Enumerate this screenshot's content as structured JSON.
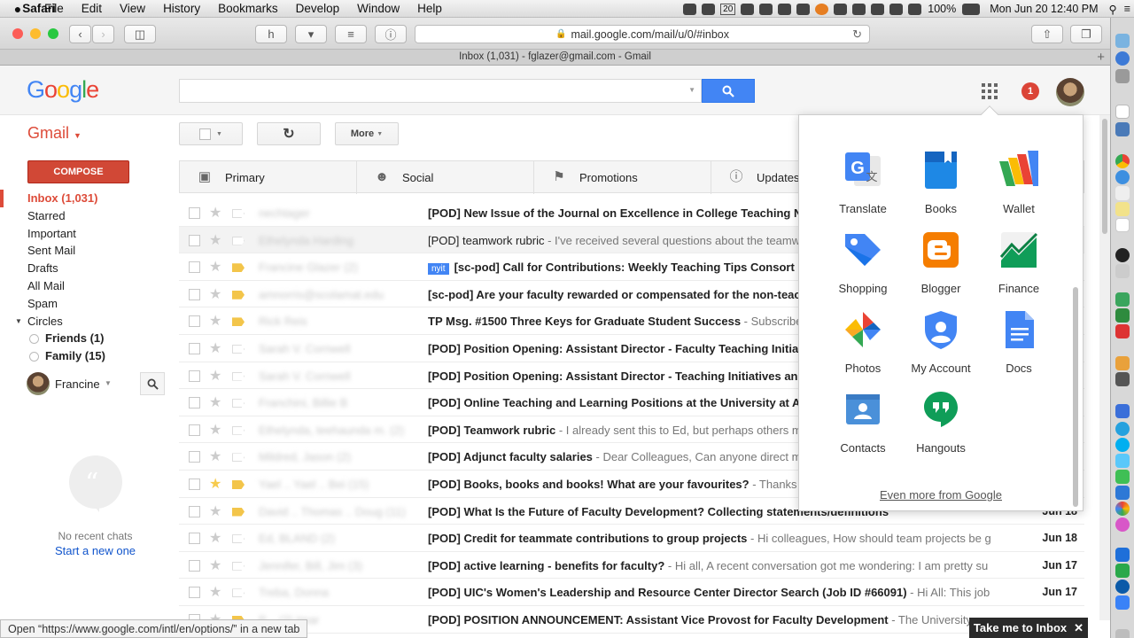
{
  "menubar": {
    "apple": "",
    "items": [
      "Safari",
      "File",
      "Edit",
      "View",
      "History",
      "Bookmarks",
      "Develop",
      "Window",
      "Help"
    ],
    "status": {
      "battery": "100%",
      "datetime": "Mon Jun 20  12:40 PM",
      "calendar_day": "20"
    }
  },
  "browser": {
    "url": "mail.google.com/mail/u/0/#inbox",
    "tab_title": "Inbox (1,031) - fglazer@gmail.com - Gmail"
  },
  "header": {
    "logo": "Google",
    "search_placeholder": "",
    "notifications": "1"
  },
  "toolbar": {
    "gmail_label": "Gmail",
    "more_label": "More",
    "compose_label": "COMPOSE"
  },
  "sidebar": {
    "items": [
      "Inbox (1,031)",
      "Starred",
      "Important",
      "Sent Mail",
      "Drafts",
      "All Mail",
      "Spam"
    ],
    "circles_label": "Circles",
    "circles": [
      "Friends (1)",
      "Family (15)"
    ],
    "chat_user": "Francine",
    "no_chats": "No recent chats",
    "start_chat": "Start a new one"
  },
  "tabs": [
    {
      "label": "Primary",
      "icon": "inbox-icon"
    },
    {
      "label": "Social",
      "icon": "people-icon"
    },
    {
      "label": "Promotions",
      "icon": "tag-icon"
    },
    {
      "label": "Updates",
      "icon": "info-icon"
    }
  ],
  "emails": [
    {
      "sender": "nechtager",
      "subject": "[POD] New Issue of the Journal on Excellence in College Teaching N",
      "snippet": "",
      "tag": "",
      "date": "",
      "read": false,
      "starred": false,
      "important": false
    },
    {
      "sender": "Ethelynda Harding",
      "subject": "[POD] teamwork rubric",
      "snippet": " - I've received several questions about the teamw",
      "tag": "",
      "date": "",
      "read": true,
      "starred": false,
      "important": false
    },
    {
      "sender": "Francine Glazer (2)",
      "subject": "[sc-pod] Call for Contributions: Weekly Teaching Tips Consort",
      "snippet": "",
      "tag": "nyit",
      "date": "",
      "read": false,
      "starred": false,
      "important": true
    },
    {
      "sender": "amnorris@scolamat.edu",
      "subject": "[sc-pod] Are your faculty rewarded or compensated for the non-teac",
      "snippet": "",
      "tag": "",
      "date": "",
      "read": false,
      "starred": false,
      "important": true
    },
    {
      "sender": "Rick Reis",
      "subject": "TP Msg. #1500 Three Keys for Graduate Student Success",
      "snippet": " - Subscribe",
      "tag": "",
      "date": "",
      "read": false,
      "starred": false,
      "important": true
    },
    {
      "sender": "Sarah V. Cornwell",
      "subject": "[POD] Position Opening: Assistant Director - Faculty Teaching Initia",
      "snippet": "",
      "tag": "",
      "date": "",
      "read": false,
      "starred": false,
      "important": false
    },
    {
      "sender": "Sarah V. Cornwell",
      "subject": "[POD] Position Opening: Assistant Director - Teaching Initiatives an",
      "snippet": "",
      "tag": "",
      "date": "",
      "read": false,
      "starred": false,
      "important": false
    },
    {
      "sender": "Franchini, Billie B",
      "subject": "[POD] Online Teaching and Learning Positions at the University at A",
      "snippet": "",
      "tag": "",
      "date": "",
      "read": false,
      "starred": false,
      "important": false
    },
    {
      "sender": "Ethelynda, teehaunda m. (2)",
      "subject": "[POD] Teamwork rubric",
      "snippet": " - I already sent this to Ed, but perhaps others m",
      "tag": "",
      "date": "",
      "read": false,
      "starred": false,
      "important": false
    },
    {
      "sender": "Mildred, Jason (2)",
      "subject": "[POD] Adjunct faculty salaries",
      "snippet": " - Dear Colleagues, Can anyone direct m",
      "tag": "",
      "date": "",
      "read": false,
      "starred": false,
      "important": false
    },
    {
      "sender": "Yael .. Yael .. Bei (15)",
      "subject": "[POD] Books, books and books! What are your favourites?",
      "snippet": " - Thanks",
      "tag": "",
      "date": "",
      "read": false,
      "starred": true,
      "important": true
    },
    {
      "sender": "David .. Thomas .. Doug (11)",
      "subject": "[POD] What Is the Future of Faculty Development? Collecting statements/definitions",
      "snippet": "",
      "tag": "",
      "date": "Jun 18",
      "read": false,
      "starred": false,
      "important": true
    },
    {
      "sender": "Ed, BLAND (2)",
      "subject": "[POD] Credit for teammate contributions to group projects",
      "snippet": " - Hi colleagues, How should team projects be g",
      "tag": "",
      "date": "Jun 18",
      "read": false,
      "starred": false,
      "important": false
    },
    {
      "sender": "Jennifer, Bill, Jim (3)",
      "subject": "[POD] active learning - benefits for faculty?",
      "snippet": " - Hi all, A recent conversation got me wondering: I am pretty su",
      "tag": "",
      "date": "Jun 17",
      "read": false,
      "starred": false,
      "important": false
    },
    {
      "sender": "Treba, Donna",
      "subject": "[POD] UIC's Women's Leadership and Resource Center Director Search (Job ID #66091)",
      "snippet": " - Hi All: This job",
      "tag": "",
      "date": "Jun 17",
      "read": false,
      "starred": false,
      "important": false
    },
    {
      "sender": "P .. (2) Imar",
      "subject": "[POD] POSITION ANNOUNCEMENT: Assistant Vice Provost for Faculty Development",
      "snippet": " - The University",
      "tag": "",
      "date": "",
      "read": false,
      "starred": false,
      "important": true
    }
  ],
  "apps_popup": {
    "apps": [
      "Translate",
      "Books",
      "Wallet",
      "Shopping",
      "Blogger",
      "Finance",
      "Photos",
      "My Account",
      "Docs",
      "Contacts",
      "Hangouts"
    ],
    "even_more": "Even more from Google"
  },
  "status_url": "Open “https://www.google.com/intl/en/options/” in a new tab",
  "take_me": "Take me to Inbox",
  "colors": {
    "gmail_red": "#dd4b39",
    "compose": "#d14836",
    "search_blue": "#4285f4"
  }
}
